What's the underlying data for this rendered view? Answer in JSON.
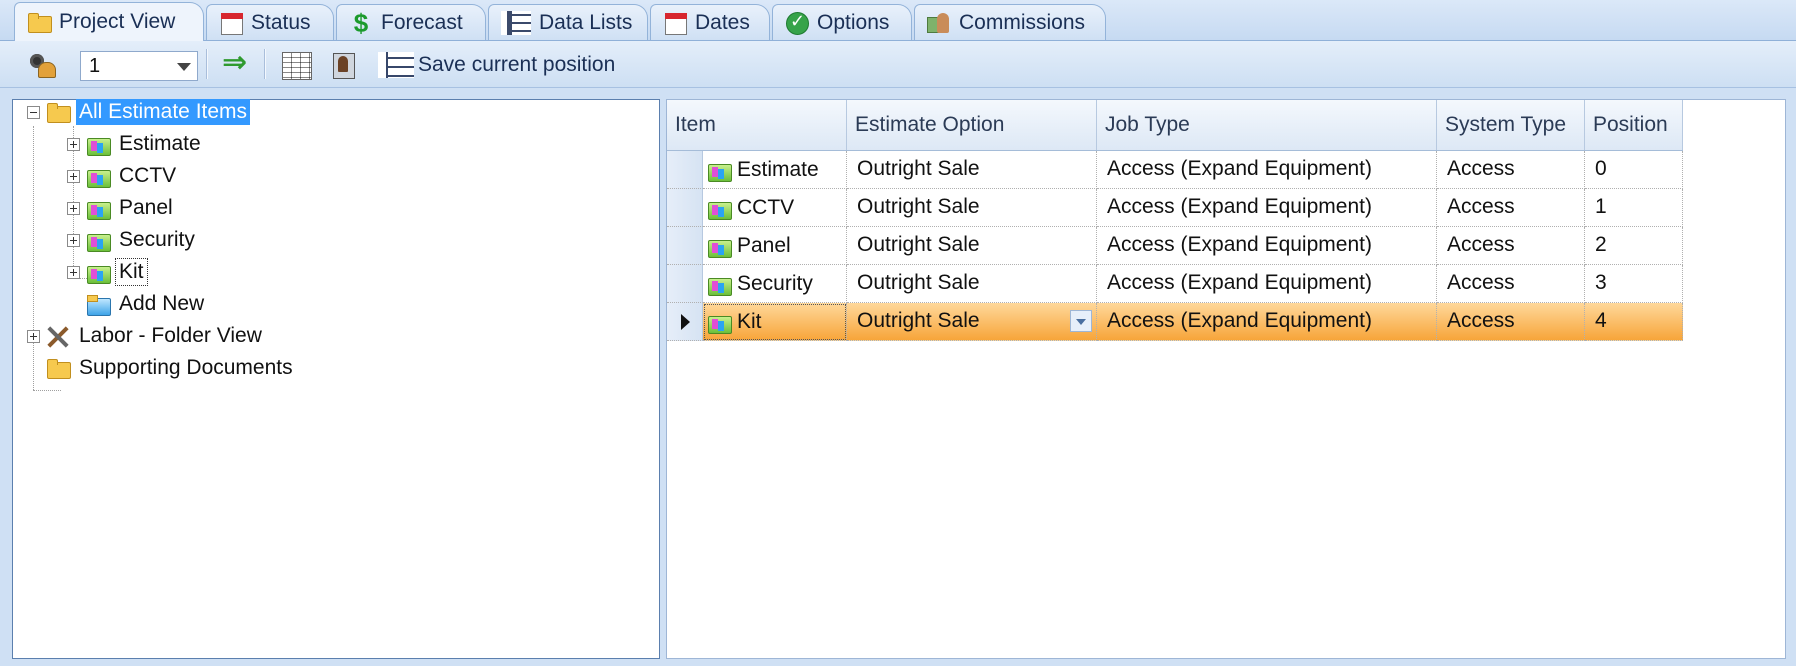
{
  "tabs": [
    {
      "label": "Project View",
      "icon": "folder-icon"
    },
    {
      "label": "Status",
      "icon": "calendar-icon"
    },
    {
      "label": "Forecast",
      "icon": "dollar-icon"
    },
    {
      "label": "Data Lists",
      "icon": "list-icon"
    },
    {
      "label": "Dates",
      "icon": "calendar-icon"
    },
    {
      "label": "Options",
      "icon": "check-circle-icon"
    },
    {
      "label": "Commissions",
      "icon": "commissions-icon"
    }
  ],
  "toolbar": {
    "position_value": "1",
    "save_label": "Save current position"
  },
  "tree": {
    "root": "All Estimate Items",
    "children": [
      "Estimate",
      "CCTV",
      "Panel",
      "Security",
      "Kit"
    ],
    "add_new": "Add New",
    "labor": "Labor - Folder View",
    "supporting": "Supporting Documents"
  },
  "grid": {
    "columns": [
      "Item",
      "Estimate Option",
      "Job Type",
      "System Type",
      "Position"
    ],
    "rows": [
      {
        "item": "Estimate",
        "option": "Outright Sale",
        "job_type": "Access (Expand Equipment)",
        "system_type": "Access",
        "position": "0"
      },
      {
        "item": "CCTV",
        "option": "Outright Sale",
        "job_type": "Access (Expand Equipment)",
        "system_type": "Access",
        "position": "1"
      },
      {
        "item": "Panel",
        "option": "Outright Sale",
        "job_type": "Access (Expand Equipment)",
        "system_type": "Access",
        "position": "2"
      },
      {
        "item": "Security",
        "option": "Outright Sale",
        "job_type": "Access (Expand Equipment)",
        "system_type": "Access",
        "position": "3"
      },
      {
        "item": "Kit",
        "option": "Outright Sale",
        "job_type": "Access (Expand Equipment)",
        "system_type": "Access",
        "position": "4"
      }
    ],
    "selected_row": 4
  },
  "colors": {
    "selection_blue": "#3399ff",
    "row_highlight": "#f7a53a",
    "chrome_blue": "#cfe0f4"
  }
}
